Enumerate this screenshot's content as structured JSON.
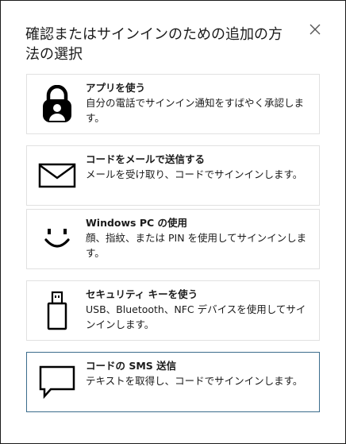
{
  "dialog": {
    "title": "確認またはサインインのための追加の方法の選択",
    "close_icon": "close-icon"
  },
  "options": [
    {
      "title": "アプリを使う",
      "description": "自分の電話でサインイン通知をすばやく承認します。",
      "icon": "authenticator-lock-icon"
    },
    {
      "title": "コードをメールで送信する",
      "description": "メールを受け取り、コードでサインインします。",
      "icon": "envelope-icon"
    },
    {
      "title": "Windows PC の使用",
      "description": "顔、指紋、または PIN を使用してサインインします。",
      "icon": "smiley-face-icon"
    },
    {
      "title": "セキュリティ キーを使う",
      "description": "USB、Bluetooth、NFC デバイスを使用してサインインします。",
      "icon": "usb-key-icon"
    },
    {
      "title": "コードの SMS 送信",
      "description": "テキストを取得し、コードでサインインします。",
      "icon": "chat-bubble-icon"
    }
  ]
}
